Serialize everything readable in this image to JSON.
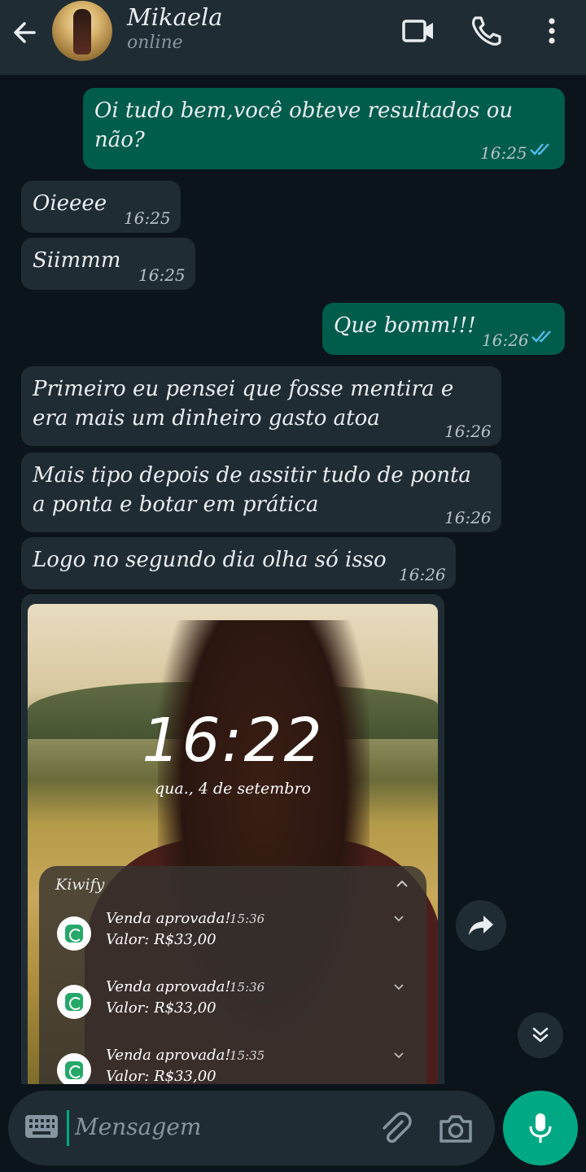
{
  "header": {
    "contact_name": "Mikaela",
    "status": "online"
  },
  "messages": [
    {
      "direction": "out",
      "text": "Oi tudo bem,você obteve resultados ou não?",
      "line1": "Oi tudo bem,você obteve resultados ou",
      "line2": "não?",
      "time": "16:25",
      "read": true
    },
    {
      "direction": "in",
      "text": "Oieeee",
      "time": "16:25"
    },
    {
      "direction": "in",
      "text": "Siimmm",
      "time": "16:25"
    },
    {
      "direction": "out",
      "text": "Que bomm!!!",
      "time": "16:26",
      "read": true
    },
    {
      "direction": "in",
      "line1": "Primeiro eu pensei que fosse mentira e",
      "line2": "era mais um dinheiro gasto atoa",
      "time": "16:26"
    },
    {
      "direction": "in",
      "line1": "Mais tipo depois de assitir tudo de ponta",
      "line2": "a ponta e botar em prática",
      "time": "16:26"
    },
    {
      "direction": "in",
      "text": "Logo no segundo dia olha só isso",
      "time": "16:26"
    }
  ],
  "media": {
    "lockscreen_time": "16:22",
    "lockscreen_date": "qua., 4 de setembro",
    "notification_app": "Kiwify",
    "notifications": [
      {
        "title": "Venda aprovada!",
        "time": "15:36",
        "value": "Valor: R$33,00"
      },
      {
        "title": "Venda aprovada!",
        "time": "15:36",
        "value": "Valor: R$33,00"
      },
      {
        "title": "Venda aprovada!",
        "time": "15:35",
        "value": "Valor: R$33,00"
      }
    ]
  },
  "input": {
    "placeholder": "Mensagem"
  },
  "colors": {
    "background": "#0b141a",
    "header": "#1f2c34",
    "outgoing_bubble": "#005c4b",
    "incoming_bubble": "#202c33",
    "accent": "#00a884",
    "read_ticks": "#53bdeb"
  },
  "icons": [
    "back-arrow-icon",
    "video-call-icon",
    "phone-call-icon",
    "more-options-icon",
    "forward-icon",
    "scroll-down-icon",
    "keyboard-icon",
    "attach-icon",
    "camera-icon",
    "mic-icon"
  ]
}
